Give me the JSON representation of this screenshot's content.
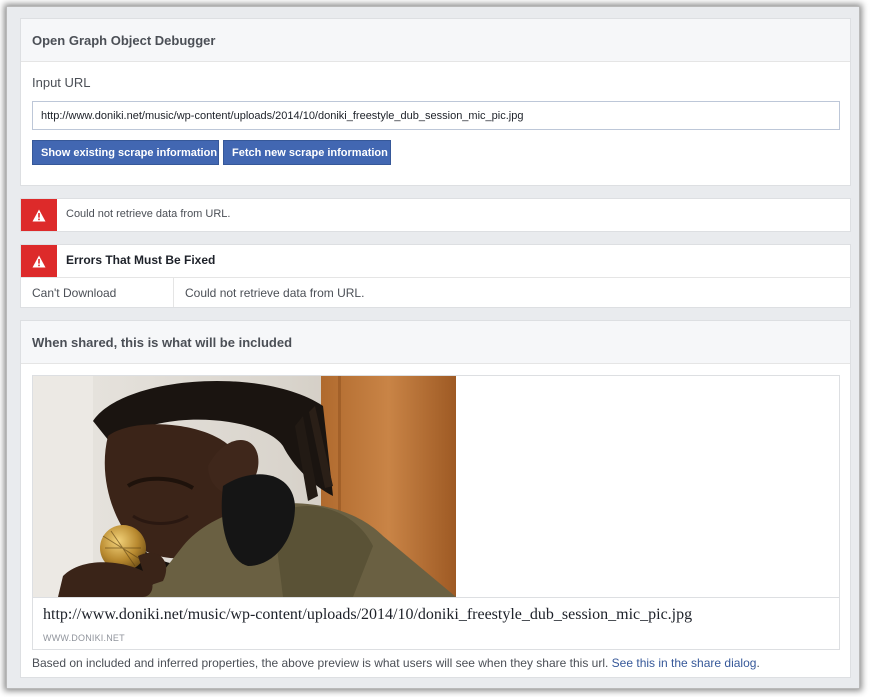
{
  "debugger": {
    "title": "Open Graph Object Debugger",
    "input_label": "Input URL",
    "input_value": "http://www.doniki.net/music/wp-content/uploads/2014/10/doniki_freestyle_dub_session_mic_pic.jpg",
    "show_button": "Show existing scrape information",
    "fetch_button": "Fetch new scrape information"
  },
  "alert": {
    "message": "Could not retrieve data from URL.",
    "icon": "warning-icon",
    "color": "#dd2a2a"
  },
  "errors": {
    "title": "Errors That Must Be Fixed",
    "icon": "warning-icon",
    "rows": [
      {
        "key": "Can't Download",
        "value": "Could not retrieve data from URL."
      }
    ]
  },
  "share": {
    "title": "When shared, this is what will be included",
    "preview_title": "http://www.doniki.net/music/wp-content/uploads/2014/10/doniki_freestyle_dub_session_mic_pic.jpg",
    "preview_domain": "WWW.DONIKI.NET",
    "note_text": "Based on included and inferred properties, the above preview is what users will see when they share this url.",
    "note_link": "See this in the share dialog",
    "note_end": "."
  },
  "colors": {
    "button": "#4267b2",
    "link": "#365899",
    "background": "#e9ebee"
  }
}
